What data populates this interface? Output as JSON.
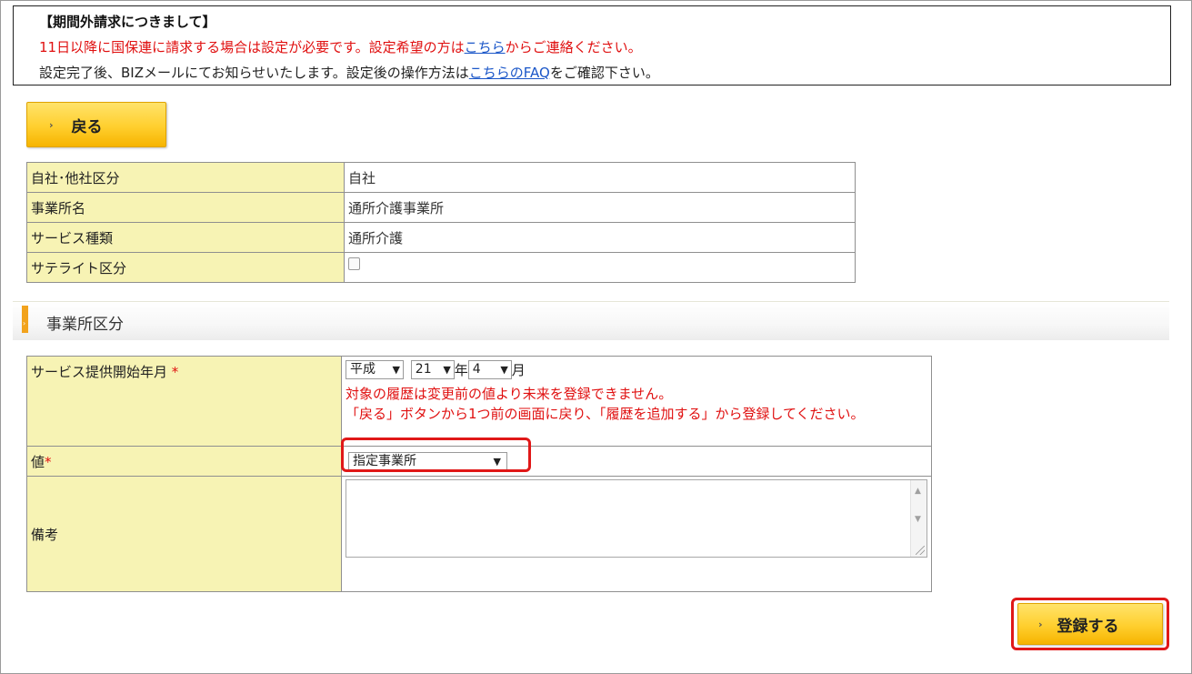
{
  "notice": {
    "title": "【期間外請求につきまして】",
    "line2_before": "11日以降に国保連に請求する場合は設定が必要です。設定希望の方は",
    "line2_link": "こちら",
    "line2_after": "からご連絡ください。",
    "line3_before": "設定完了後、BIZメールにてお知らせいたします。設定後の操作方法は",
    "line3_link": "こちらのFAQ",
    "line3_after": "をご確認下さい。"
  },
  "buttons": {
    "back_chevron": "›",
    "back_label": "戻る",
    "register_chevron": "›",
    "register_label": "登録する"
  },
  "info_table": {
    "rows": [
      {
        "label": "自社･他社区分",
        "value": "自社"
      },
      {
        "label": "事業所名",
        "value": "通所介護事業所"
      },
      {
        "label": "サービス種類",
        "value": "通所介護"
      },
      {
        "label": "サテライト区分",
        "checked": false
      }
    ]
  },
  "section": {
    "title": "事業所区分"
  },
  "form": {
    "start_label": "サービス提供開始年月",
    "required_mark": "*",
    "era": "平成",
    "year": "21",
    "year_unit": "年",
    "month": "4",
    "month_unit": "月",
    "error_1": "対象の履歴は変更前の値より未来を登録できません。",
    "error_2": "「戻る」ボタンから1つ前の画面に戻り、「履歴を追加する」から登録してください。",
    "value_label": "値",
    "value_selected": "指定事業所",
    "remarks_label": "備考",
    "remarks_value": ""
  },
  "icons": {
    "dropdown_arrow": "▼",
    "scroll_up": "▲",
    "scroll_down": "▼"
  },
  "colors": {
    "label_bg": "#f7f3b4",
    "button_yellow": "#ffcf2e",
    "error_red": "#e01010",
    "highlight_red": "#e01818",
    "section_accent": "#f2a31d",
    "link_blue": "#1a56c8"
  }
}
